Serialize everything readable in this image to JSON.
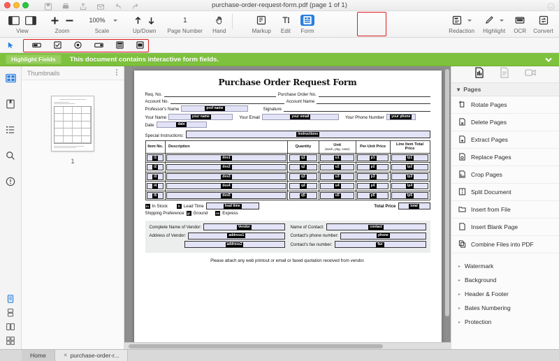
{
  "window": {
    "title": "purchase-order-request-form.pdf (page 1 of 1)",
    "traffic": [
      "close",
      "minimize",
      "zoom"
    ],
    "quick_icons": [
      "save-icon",
      "print-icon",
      "share-icon",
      "mail-icon",
      "undo-icon",
      "redo-icon"
    ]
  },
  "toolbar": {
    "groups": [
      {
        "label": "View",
        "name": "view-group"
      },
      {
        "label": "Zoom",
        "name": "zoom-group"
      },
      {
        "label": "Scale",
        "name": "scale-group"
      },
      {
        "label": "Up/Down",
        "name": "updown-group"
      },
      {
        "label": "Page Number",
        "name": "pagenumber-group"
      },
      {
        "label": "Hand",
        "name": "hand-group"
      }
    ],
    "zoom_value": "100%",
    "page_number": "1",
    "right_groups": [
      {
        "label": "Markup",
        "name": "markup-group"
      },
      {
        "label": "Edit",
        "name": "edit-group"
      },
      {
        "label": "Form",
        "name": "form-group",
        "active": true
      }
    ],
    "far_right_groups": [
      {
        "label": "Redaction",
        "name": "redaction-group"
      },
      {
        "label": "Highlight",
        "name": "highlight-group"
      },
      {
        "label": "OCR",
        "name": "ocr-group"
      },
      {
        "label": "Convert",
        "name": "convert-group"
      }
    ]
  },
  "form_tools": [
    {
      "name": "text-field-tool"
    },
    {
      "name": "checkbox-tool"
    },
    {
      "name": "radio-button-tool"
    },
    {
      "name": "combo-box-tool"
    },
    {
      "name": "list-box-tool"
    },
    {
      "name": "push-button-tool"
    }
  ],
  "banner": {
    "button_label": "Highlight Fields",
    "message": "This document contains interactive form fields.",
    "bg_color": "#7ec13e",
    "button_color": "#98cf5e"
  },
  "left_rail": {
    "items": [
      {
        "name": "thumbnails-icon",
        "active": true
      },
      {
        "name": "bookmarks-icon",
        "active": false
      },
      {
        "name": "outline-icon",
        "active": false
      },
      {
        "name": "search-icon",
        "active": false
      },
      {
        "name": "info-icon",
        "active": false
      }
    ],
    "bottom_items": [
      {
        "name": "single-page-view-icon",
        "active": true
      },
      {
        "name": "continuous-view-icon",
        "active": false
      },
      {
        "name": "two-page-view-icon",
        "active": false
      },
      {
        "name": "grid-view-icon",
        "active": false
      }
    ]
  },
  "thumbnail_panel": {
    "title": "Thumbnails",
    "menu_icon": "more-options-icon",
    "page_label": "1"
  },
  "document": {
    "title": "Purchase Order Request Form",
    "line1": {
      "label_a": "Req. No.",
      "label_b": "Purchase Order No."
    },
    "line2": {
      "label_a": "Account No.",
      "label_b": "Account Name"
    },
    "line3": {
      "label_a": "Professor's Name",
      "field_a": "prof name",
      "label_b": "Signature"
    },
    "line4": {
      "label_a": "Your Name",
      "field_a": "your name",
      "label_b": "Your Email",
      "field_b": "your email",
      "label_c": "Your Phone Number",
      "field_c": "your phone"
    },
    "line5": {
      "label_a": "Date",
      "field_a": "date"
    },
    "special": {
      "label": "Special Instructions:",
      "field": "instructions"
    },
    "table": {
      "headers": [
        {
          "text": "Item No.",
          "sub": ""
        },
        {
          "text": "Description",
          "sub": ""
        },
        {
          "text": "Quantity",
          "sub": ""
        },
        {
          "text": "Unit",
          "sub": "(each, pkg, case)"
        },
        {
          "text": "Per-Unit Price",
          "sub": ""
        },
        {
          "text": "Line Item Total Price",
          "sub": ""
        }
      ],
      "rows": [
        {
          "item": "i1",
          "desc": "des1",
          "qty": "q1",
          "unit": "u1",
          "price": "p1",
          "total": "lp1"
        },
        {
          "item": "i2",
          "desc": "des2",
          "qty": "q2",
          "unit": "u2",
          "price": "p2",
          "total": "lp2"
        },
        {
          "item": "i3",
          "desc": "des3",
          "qty": "q3",
          "unit": "u3",
          "price": "p3",
          "total": "lp3"
        },
        {
          "item": "i4",
          "desc": "des4",
          "qty": "q4",
          "unit": "u4",
          "price": "p4",
          "total": "lp4"
        },
        {
          "item": "i5",
          "desc": "des5",
          "qty": "q5",
          "unit": "u5",
          "price": "p5",
          "total": "lp5"
        }
      ]
    },
    "options": {
      "instock_field": "in",
      "instock_label": "In Stock",
      "leadtime_check": "lt",
      "leadtime_label": "Lead Time",
      "leadtime_field": "lead time",
      "total_label": "Total Price",
      "total_field": "total",
      "shipping_label": "Shipping Preference",
      "ground_check": "gr",
      "ground_label": "Ground",
      "express_check": "ex",
      "express_label": "Express"
    },
    "vendor": {
      "name_label": "Complete Name of Vendor:",
      "name_field": "Vendor",
      "addr_label": "Address of Vendor:",
      "addr_field1": "address1",
      "addr_field2": "address2",
      "contact_label": "Name of Contact:",
      "contact_field": "contact",
      "phone_label": "Contact's phone number:",
      "phone_field": "phone",
      "fax_label": "Contact's fax number:",
      "fax_field": "fax"
    },
    "footer": "Please attach any web printout or email or faxed quotation received from vendor.",
    "field_highlight_color": "#e3e3f7"
  },
  "right_panel": {
    "tabs": [
      {
        "name": "pages-tab",
        "active": true
      },
      {
        "name": "properties-tab",
        "active": false
      },
      {
        "name": "media-tab",
        "active": false
      }
    ],
    "section_title": "Pages",
    "items": [
      {
        "label": "Rotate Pages",
        "icon": "rotate-icon"
      },
      {
        "label": "Delete Pages",
        "icon": "delete-icon"
      },
      {
        "label": "Extract Pages",
        "icon": "extract-icon"
      },
      {
        "label": "Replace Pages",
        "icon": "replace-icon"
      },
      {
        "label": "Crop Pages",
        "icon": "crop-icon"
      },
      {
        "label": "Split Document",
        "icon": "split-icon"
      },
      {
        "label": "Insert from File",
        "icon": "folder-icon"
      },
      {
        "label": "Insert Blank Page",
        "icon": "blank-page-icon"
      },
      {
        "label": "Combine Files into PDF",
        "icon": "combine-icon"
      }
    ],
    "sections": [
      {
        "label": "Watermark"
      },
      {
        "label": "Background"
      },
      {
        "label": "Header & Footer"
      },
      {
        "label": "Bates Numbering"
      },
      {
        "label": "Protection"
      }
    ]
  },
  "bottom_tabs": [
    {
      "label": "Home",
      "closable": false,
      "active": false
    },
    {
      "label": "purchase-order-r...",
      "closable": true,
      "active": true
    }
  ]
}
